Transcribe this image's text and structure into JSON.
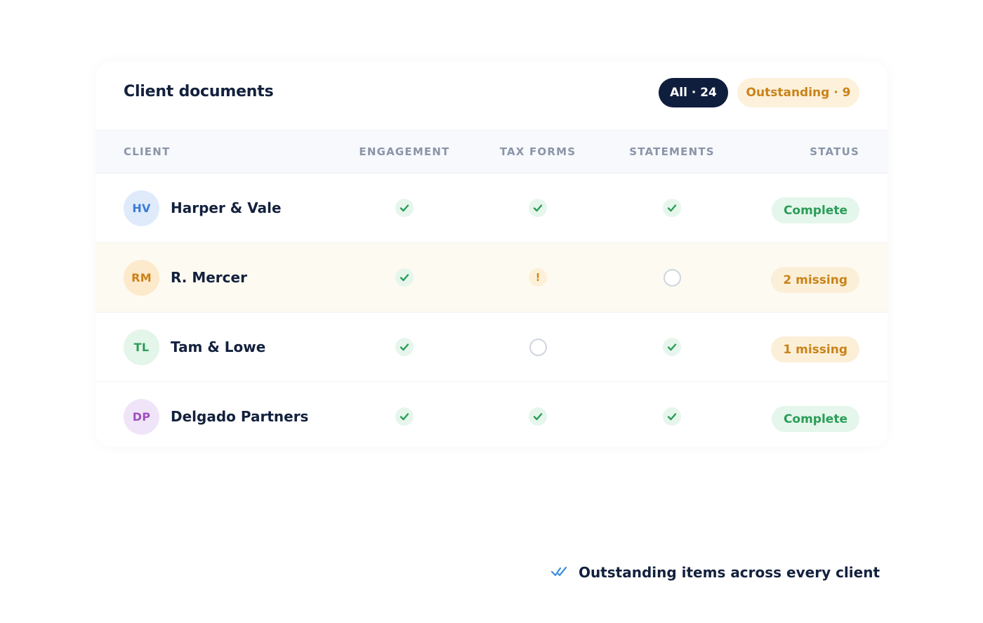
{
  "header": {
    "title": "Client documents",
    "filters": [
      {
        "label": "All · 24",
        "active": true
      },
      {
        "label": "Outstanding · 9",
        "active": false
      }
    ]
  },
  "columns": {
    "client": "CLIENT",
    "engagement": "ENGAGEMENT",
    "tax_forms": "TAX FORMS",
    "statements": "STATEMENTS",
    "status": "STATUS"
  },
  "rows": [
    {
      "initials": "HV",
      "name": "Harper & Vale",
      "engagement": "done",
      "tax_forms": "done",
      "statements": "done",
      "status": "Complete",
      "status_type": "complete",
      "avatar_bg": "#dfeafb",
      "avatar_fg": "#3b7bd4",
      "highlight": false
    },
    {
      "initials": "RM",
      "name": "R. Mercer",
      "engagement": "done",
      "tax_forms": "warning",
      "statements": "empty",
      "status": "2 missing",
      "status_type": "missing",
      "avatar_bg": "#fde9cc",
      "avatar_fg": "#c98318",
      "highlight": true
    },
    {
      "initials": "TL",
      "name": "Tam & Lowe",
      "engagement": "done",
      "tax_forms": "empty",
      "statements": "done",
      "status": "1 missing",
      "status_type": "missing",
      "avatar_bg": "#e4f5ea",
      "avatar_fg": "#2a9d57",
      "highlight": false
    },
    {
      "initials": "DP",
      "name": "Delgado Partners",
      "engagement": "done",
      "tax_forms": "done",
      "statements": "done",
      "status": "Complete",
      "status_type": "complete",
      "avatar_bg": "#f0e5f8",
      "avatar_fg": "#a04fc0",
      "highlight": false
    }
  ],
  "footer": {
    "icon": "double-check-icon",
    "text": "Outstanding items across every client"
  },
  "colors": {
    "navy": "#0f1e3d",
    "success": "#2a9d57",
    "warning": "#c98318",
    "accent_blue": "#3b8ee0"
  }
}
